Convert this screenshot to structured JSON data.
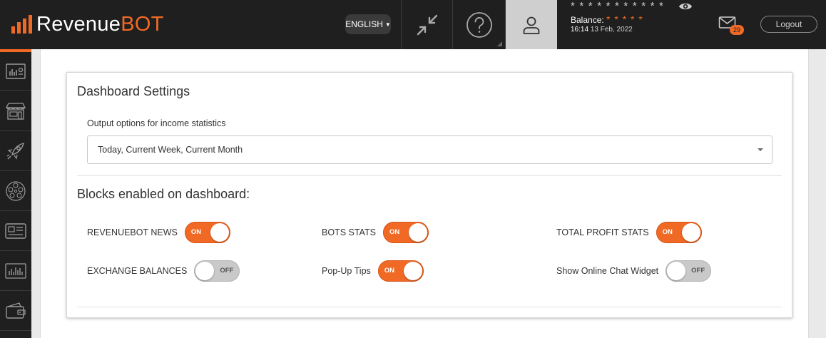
{
  "header": {
    "logo": {
      "text_main": "Revenue",
      "text_accent": "BOT"
    },
    "language": {
      "label": "ENGLISH"
    },
    "account": {
      "masked_value": "* * * * * * * * * * *",
      "balance_label": "Balance:",
      "balance_masked": "* * * * *",
      "time": "16:14",
      "date": "13 Feb, 2022"
    },
    "messages": {
      "badge_count": "29"
    },
    "logout_label": "Logout"
  },
  "colors": {
    "accent": "#f06a25",
    "topbar": "#1f1f1f",
    "active_user_tab": "#cfcfcf",
    "toggle_off": "#c9c9c9"
  },
  "sidebar": {
    "items": [
      {
        "icon": "dashboard-stats-icon"
      },
      {
        "icon": "store-icon"
      },
      {
        "icon": "rocket-icon"
      },
      {
        "icon": "network-icon"
      },
      {
        "icon": "id-card-icon"
      },
      {
        "icon": "bar-chart-icon"
      },
      {
        "icon": "wallet-icon"
      }
    ]
  },
  "main": {
    "title": "Dashboard Settings",
    "output_options": {
      "label": "Output options for income statistics",
      "selected_value": "Today, Current Week, Current Month"
    },
    "blocks_section_title": "Blocks enabled on dashboard:",
    "toggles": [
      {
        "label": "REVENUEBOT NEWS",
        "state": "ON"
      },
      {
        "label": "BOTS STATS",
        "state": "ON"
      },
      {
        "label": "TOTAL PROFIT STATS",
        "state": "ON"
      },
      {
        "label": "EXCHANGE BALANCES",
        "state": "OFF"
      },
      {
        "label": "Pop-Up Tips",
        "state": "ON"
      },
      {
        "label": "Show Online Chat Widget",
        "state": "OFF"
      }
    ]
  }
}
